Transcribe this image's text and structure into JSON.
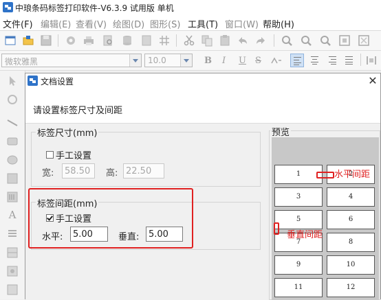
{
  "app": {
    "title": "中琅条码标签打印软件-V6.3.9 试用版 单机"
  },
  "menu": [
    {
      "label": "文件(F)",
      "enabled": true
    },
    {
      "label": "编辑(E)",
      "enabled": false
    },
    {
      "label": "查看(V)",
      "enabled": false
    },
    {
      "label": "绘图(D)",
      "enabled": false
    },
    {
      "label": "图形(S)",
      "enabled": false
    },
    {
      "label": "工具(T)",
      "enabled": true
    },
    {
      "label": "窗口(W)",
      "enabled": false
    },
    {
      "label": "帮助(H)",
      "enabled": true
    }
  ],
  "toolbar2": {
    "font_name": "微软雅黑",
    "font_size": "10.0"
  },
  "dialog": {
    "title": "文档设置",
    "close": "✕",
    "header_text": "请设置标签尺寸及间距",
    "label_size": {
      "group_label": "标签尺寸(mm)",
      "manual_label": "手工设置",
      "manual_checked": false,
      "width_label": "宽:",
      "width_value": "58.50",
      "height_label": "高:",
      "height_value": "22.50"
    },
    "label_spacing": {
      "group_label": "标签间距(mm)",
      "manual_label": "手工设置",
      "manual_checked": true,
      "horizontal_label": "水平:",
      "horizontal_value": "5.00",
      "vertical_label": "垂直:",
      "vertical_value": "5.00"
    },
    "preview": {
      "label": "预览",
      "cells": [
        "1",
        "2",
        "3",
        "4",
        "5",
        "6",
        "7",
        "8",
        "9",
        "10",
        "11",
        "12"
      ]
    },
    "annotations": {
      "horizontal": "水平间距",
      "vertical": "垂直间距"
    }
  },
  "colors": {
    "annotation_red": "#e02020",
    "accent_blue": "#2f73c8"
  }
}
